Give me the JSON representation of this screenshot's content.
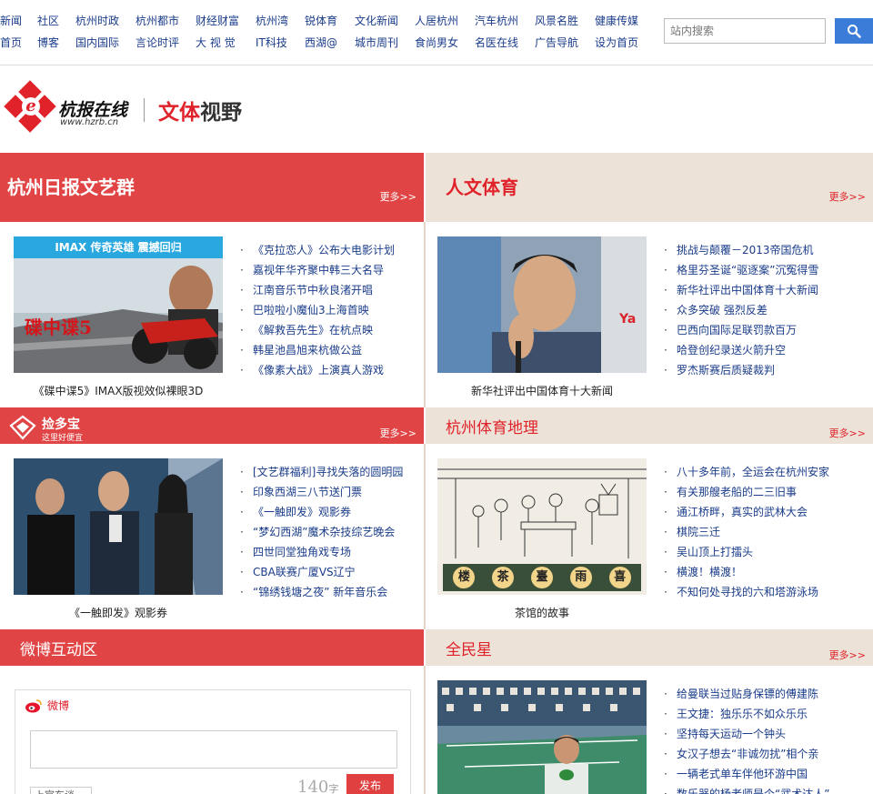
{
  "nav": {
    "row1": [
      "新闻",
      "社区",
      "杭州时政",
      "杭州都市",
      "财经财富",
      "杭州湾",
      "锐体育",
      "文化新闻",
      "人居杭州",
      "汽车杭州",
      "风景名胜",
      "健康传媒"
    ],
    "row2": [
      "首页",
      "博客",
      "国内国际",
      "言论时评",
      "大 视 觉",
      "IT科技",
      "西湖@",
      "城市周刊",
      "食尚男女",
      "名医在线",
      "广告导航",
      "设为首页"
    ],
    "search_placeholder": "站内搜索"
  },
  "logo": {
    "name": "杭报在线",
    "url": "www.hzrb.cn",
    "channel_a": "文体",
    "channel_b": "视野"
  },
  "more_label": "更多>>",
  "sections": {
    "literary": {
      "title": "杭州日报文艺群",
      "caption": "《碟中谍5》IMAX版视效似裸眼3D",
      "banner": "IMAX 传奇英雄  震撼回归",
      "poster": "碟中谍5",
      "items": [
        "《克拉恋人》公布大电影计划",
        "嘉视年华齐聚中韩三大名导",
        "江南音乐节中秋良渚开唱",
        "巴啦啦小魔仙3上海首映",
        "《解救吾先生》在杭点映",
        "韩星池昌旭来杭做公益",
        "《像素大战》上演真人游戏"
      ]
    },
    "sports": {
      "title": "人文体育",
      "caption": "新华社评出中国体育十大新闻",
      "items": [
        "挑战与颠覆－2013帝国危机",
        "格里芬圣诞“驱逐案”沉冤得雪",
        "新华社评出中国体育十大新闻",
        "众多突破  强烈反差",
        "巴西向国际足联罚款百万",
        "哈登创纪录送火箭升空",
        "罗杰斯赛后质疑裁判"
      ]
    },
    "deals": {
      "brand": "捡多宝",
      "slogan": "这里好便宜",
      "caption": "《一触即发》观影券",
      "items": [
        "[文艺群福利]寻找失落的圆明园",
        "印象西湖三八节送门票",
        "《一触即发》观影券",
        "“梦幻西湖”魔术杂技综艺晚会",
        "四世同堂独角戏专场",
        "CBA联赛广厦VS辽宁",
        "“锦绣钱塘之夜”  新年音乐会"
      ]
    },
    "geo": {
      "title": "杭州体育地理",
      "caption": "茶馆的故事",
      "sign": [
        "楼",
        "茶",
        "臺",
        "雨",
        "喜"
      ],
      "items": [
        "八十多年前，全运会在杭州安家",
        "有关那艘老船的二三旧事",
        "通江桥畔，真实的武林大会",
        "棋院三迁",
        "吴山顶上打擂头",
        "横渡！横渡！",
        "不知何处寻找的六和塔游泳场"
      ]
    },
    "weibo": {
      "title": "微博互动区",
      "brand": "微博",
      "count": "140",
      "count_unit": "字",
      "post": "发布",
      "tab": "上官东谈"
    },
    "allstar": {
      "title": "全民星",
      "items": [
        "给曼联当过贴身保镖的傅建陈",
        "王文捷：独乐乐不如众乐乐",
        "坚持每天运动一个钟头",
        "女汉子想去“非诚勿扰”相个亲",
        "一辆老式单车伴他环游中国",
        "数乐器的杨老师是个“武术达人”"
      ]
    }
  },
  "colors": {
    "accent": "#e04444",
    "beige": "#ece2d8",
    "link": "#1a3c8a"
  }
}
